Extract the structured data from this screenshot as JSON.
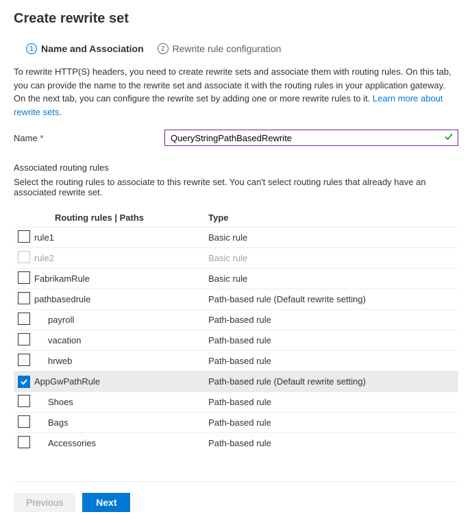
{
  "title": "Create rewrite set",
  "tabs": [
    {
      "num": "1",
      "label": "Name and Association",
      "active": true
    },
    {
      "num": "2",
      "label": "Rewrite rule configuration",
      "active": false
    }
  ],
  "description_parts": {
    "text": "To rewrite HTTP(S) headers, you need to create rewrite sets and associate them with routing rules. On this tab, you can provide the name to the rewrite set and associate it with the routing rules in your application gateway. On the next tab, you can configure the rewrite set by adding one or more rewrite rules to it. ",
    "link": "Learn more about rewrite sets."
  },
  "form": {
    "name_label": "Name",
    "name_value": "QueryStringPathBasedRewrite"
  },
  "section": {
    "title": "Associated routing rules",
    "sub": "Select the routing rules to associate to this rewrite set. You can't select routing rules that already have an associated rewrite set."
  },
  "table": {
    "headers": {
      "name": "Routing rules | Paths",
      "type": "Type"
    },
    "rows": [
      {
        "name": "rule1",
        "type": "Basic rule",
        "checked": false,
        "disabled": false,
        "child": false
      },
      {
        "name": "rule2",
        "type": "Basic rule",
        "checked": false,
        "disabled": true,
        "child": false
      },
      {
        "name": "FabrikamRule",
        "type": "Basic rule",
        "checked": false,
        "disabled": false,
        "child": false
      },
      {
        "name": "pathbasedrule",
        "type": "Path-based rule (Default rewrite setting)",
        "checked": false,
        "disabled": false,
        "child": false
      },
      {
        "name": "payroll",
        "type": "Path-based rule",
        "checked": false,
        "disabled": false,
        "child": true
      },
      {
        "name": "vacation",
        "type": "Path-based rule",
        "checked": false,
        "disabled": false,
        "child": true
      },
      {
        "name": "hrweb",
        "type": "Path-based rule",
        "checked": false,
        "disabled": false,
        "child": true
      },
      {
        "name": "AppGwPathRule",
        "type": "Path-based rule (Default rewrite setting)",
        "checked": true,
        "disabled": false,
        "child": false
      },
      {
        "name": "Shoes",
        "type": "Path-based rule",
        "checked": false,
        "disabled": false,
        "child": true
      },
      {
        "name": "Bags",
        "type": "Path-based rule",
        "checked": false,
        "disabled": false,
        "child": true
      },
      {
        "name": "Accessories",
        "type": "Path-based rule",
        "checked": false,
        "disabled": false,
        "child": true
      }
    ]
  },
  "footer": {
    "previous": "Previous",
    "next": "Next"
  }
}
